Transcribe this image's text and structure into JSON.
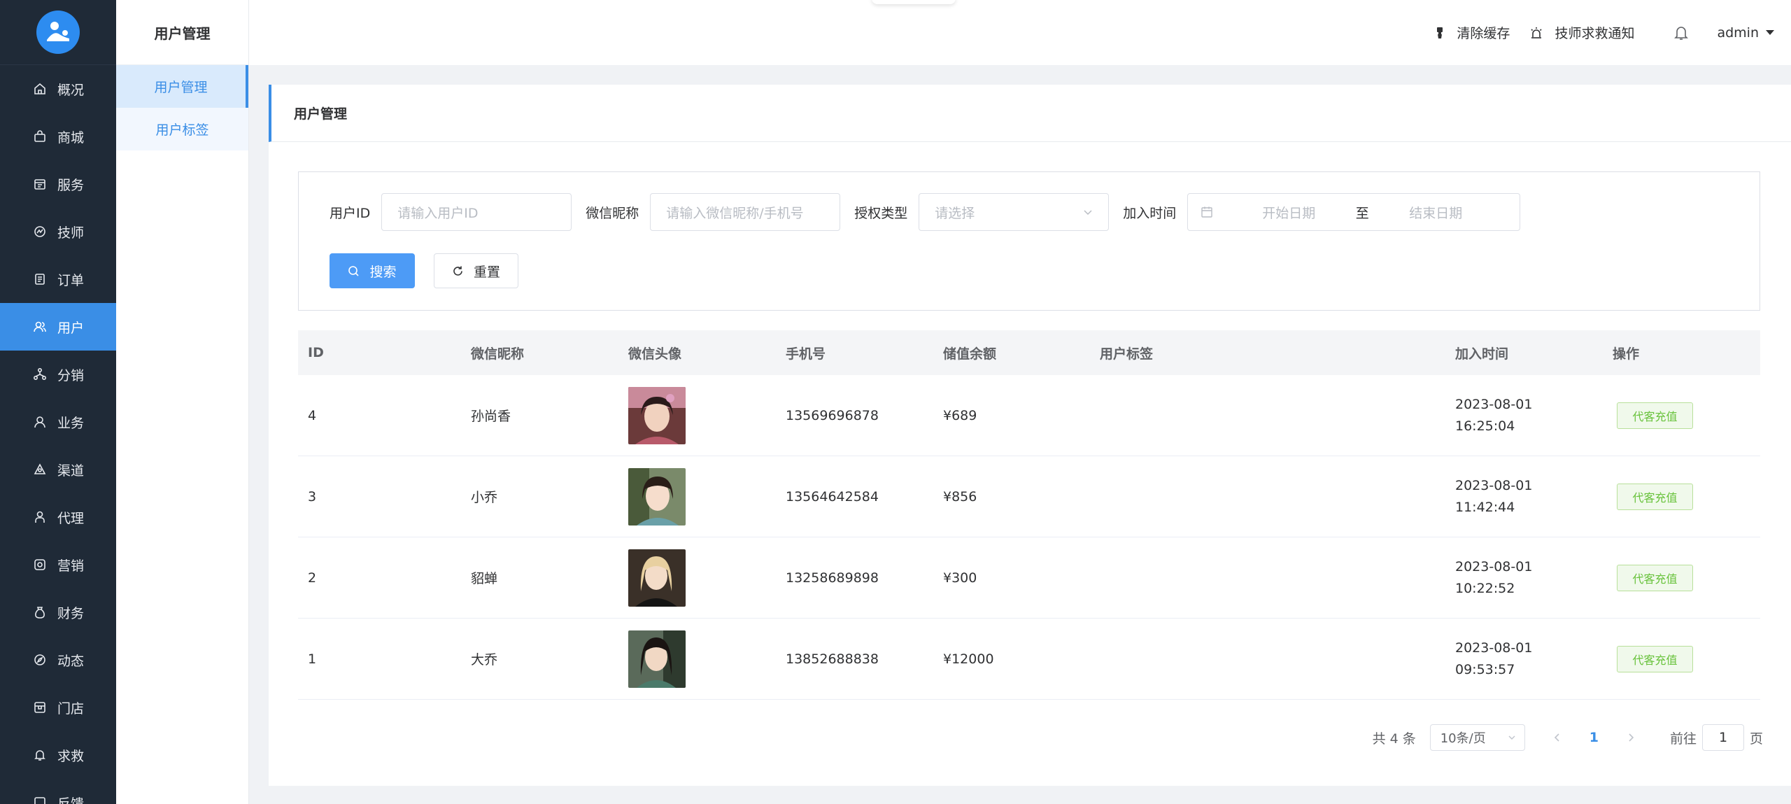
{
  "sidebar": {
    "items": [
      {
        "label": "概况",
        "icon": "home-icon"
      },
      {
        "label": "商城",
        "icon": "shopping-bag-icon"
      },
      {
        "label": "服务",
        "icon": "service-icon"
      },
      {
        "label": "技师",
        "icon": "technician-icon"
      },
      {
        "label": "订单",
        "icon": "order-icon"
      },
      {
        "label": "用户",
        "icon": "user-group-icon",
        "active": true
      },
      {
        "label": "分销",
        "icon": "distribution-icon"
      },
      {
        "label": "业务",
        "icon": "business-icon"
      },
      {
        "label": "渠道",
        "icon": "channel-icon"
      },
      {
        "label": "代理",
        "icon": "agent-icon"
      },
      {
        "label": "营销",
        "icon": "marketing-icon"
      },
      {
        "label": "财务",
        "icon": "finance-icon"
      },
      {
        "label": "动态",
        "icon": "compass-icon"
      },
      {
        "label": "门店",
        "icon": "store-icon"
      },
      {
        "label": "求救",
        "icon": "bell-icon"
      },
      {
        "label": "反馈",
        "icon": "feedback-icon"
      }
    ]
  },
  "subnav": {
    "title": "用户管理",
    "items": [
      {
        "label": "用户管理",
        "active": true
      },
      {
        "label": "用户标签"
      }
    ]
  },
  "header": {
    "clear_cache": "清除缓存",
    "rescue_notice": "技师求救通知",
    "username": "admin"
  },
  "page": {
    "title": "用户管理"
  },
  "filters": {
    "user_id_label": "用户ID",
    "user_id_placeholder": "请输入用户ID",
    "nickname_label": "微信昵称",
    "nickname_placeholder": "请输入微信昵称/手机号",
    "auth_label": "授权类型",
    "auth_placeholder": "请选择",
    "time_label": "加入时间",
    "start_placeholder": "开始日期",
    "range_sep": "至",
    "end_placeholder": "结束日期",
    "search_button": "搜索",
    "reset_button": "重置"
  },
  "table": {
    "columns": [
      "ID",
      "微信昵称",
      "微信头像",
      "手机号",
      "储值余额",
      "用户标签",
      "加入时间",
      "操作"
    ],
    "action_label": "代客充值",
    "rows": [
      {
        "id": "4",
        "nickname": "孙尚香",
        "phone": "13569696878",
        "balance": "¥689",
        "tag": "",
        "date": "2023-08-01",
        "time": "16:25:04"
      },
      {
        "id": "3",
        "nickname": "小乔",
        "phone": "13564642584",
        "balance": "¥856",
        "tag": "",
        "date": "2023-08-01",
        "time": "11:42:44"
      },
      {
        "id": "2",
        "nickname": "貂蝉",
        "phone": "13258689898",
        "balance": "¥300",
        "tag": "",
        "date": "2023-08-01",
        "time": "10:22:52"
      },
      {
        "id": "1",
        "nickname": "大乔",
        "phone": "13852688838",
        "balance": "¥12000",
        "tag": "",
        "date": "2023-08-01",
        "time": "09:53:57"
      }
    ]
  },
  "pagination": {
    "total": "共 4 条",
    "page_size": "10条/页",
    "current": "1",
    "goto_prefix": "前往",
    "goto_value": "1",
    "goto_suffix": "页"
  },
  "colors": {
    "sidebar_bg": "#1f2a37",
    "accent": "#3a8ee6",
    "success": "#67c23a"
  }
}
